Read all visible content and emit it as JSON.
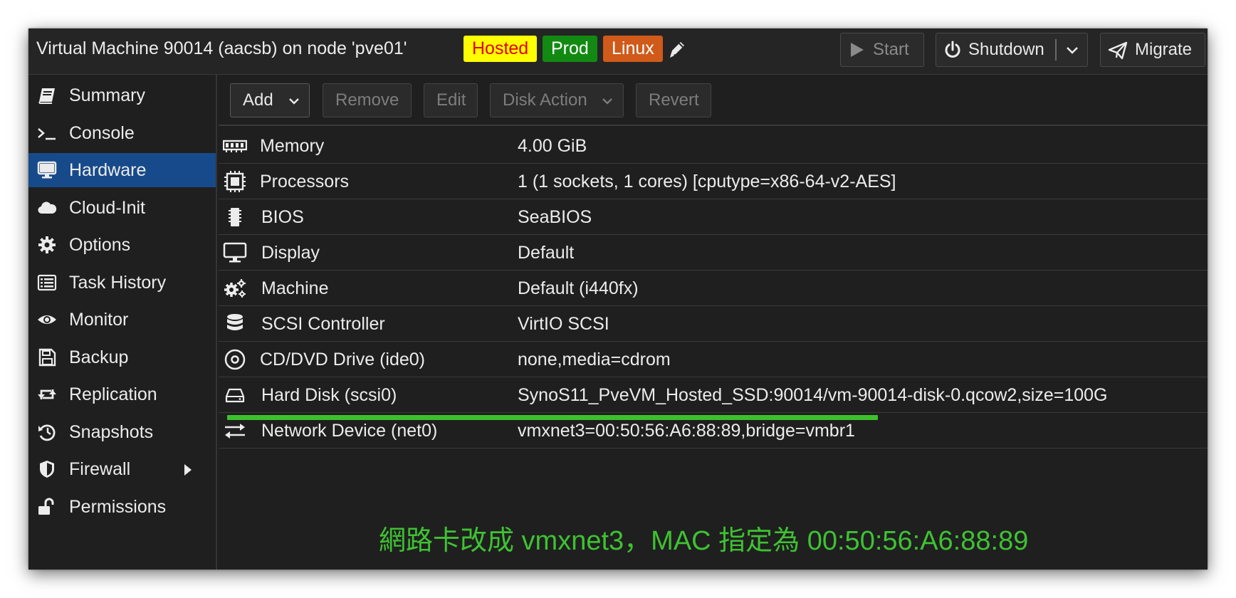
{
  "header": {
    "title": "Virtual Machine 90014 (aacsb) on node 'pve01'",
    "tags": [
      {
        "label": "Hosted",
        "bg": "#ffff00",
        "fg": "#e00000"
      },
      {
        "label": "Prod",
        "bg": "#128a12",
        "fg": "#ffffff"
      },
      {
        "label": "Linux",
        "bg": "#d05a1a",
        "fg": "#ffffff"
      }
    ],
    "edit_tags_icon": "pencil-icon",
    "buttons": {
      "start": {
        "label": "Start",
        "icon": "play-icon",
        "enabled": false
      },
      "shutdown": {
        "label": "Shutdown",
        "icon": "power-icon",
        "has_menu": true
      },
      "migrate": {
        "label": "Migrate",
        "icon": "paper-plane-icon"
      }
    }
  },
  "sidebar": {
    "items": [
      {
        "label": "Summary",
        "icon": "book-icon"
      },
      {
        "label": "Console",
        "icon": "terminal-icon"
      },
      {
        "label": "Hardware",
        "icon": "desktop-icon",
        "active": true
      },
      {
        "label": "Cloud-Init",
        "icon": "cloud-icon"
      },
      {
        "label": "Options",
        "icon": "gear-icon"
      },
      {
        "label": "Task History",
        "icon": "list-icon"
      },
      {
        "label": "Monitor",
        "icon": "eye-icon"
      },
      {
        "label": "Backup",
        "icon": "floppy-icon"
      },
      {
        "label": "Replication",
        "icon": "retweet-icon"
      },
      {
        "label": "Snapshots",
        "icon": "history-icon"
      },
      {
        "label": "Firewall",
        "icon": "shield-icon",
        "expandable": true
      },
      {
        "label": "Permissions",
        "icon": "unlock-icon"
      }
    ]
  },
  "toolbar": {
    "add": "Add",
    "remove": "Remove",
    "edit": "Edit",
    "disk_action": "Disk Action",
    "revert": "Revert"
  },
  "hardware": {
    "rows": [
      {
        "name": "Memory",
        "value": "4.00 GiB",
        "icon": "memory-icon"
      },
      {
        "name": "Processors",
        "value": "1 (1 sockets, 1 cores) [cputype=x86-64-v2-AES]",
        "icon": "cpu-icon"
      },
      {
        "name": "BIOS",
        "value": "SeaBIOS",
        "icon": "microchip-icon"
      },
      {
        "name": "Display",
        "value": "Default",
        "icon": "desktop-icon"
      },
      {
        "name": "Machine",
        "value": "Default (i440fx)",
        "icon": "cogs-icon"
      },
      {
        "name": "SCSI Controller",
        "value": "VirtIO SCSI",
        "icon": "database-icon"
      },
      {
        "name": "CD/DVD Drive (ide0)",
        "value": "none,media=cdrom",
        "icon": "cdrom-icon"
      },
      {
        "name": "Hard Disk (scsi0)",
        "value": "SynoS11_PveVM_Hosted_SSD:90014/vm-90014-disk-0.qcow2,size=100G",
        "icon": "hdd-icon"
      },
      {
        "name": "Network Device (net0)",
        "value": "vmxnet3=00:50:56:A6:88:89,bridge=vmbr1",
        "icon": "exchange-icon"
      }
    ]
  },
  "annotation": {
    "text": "網路卡改成 vmxnet3，MAC 指定為 00:50:56:A6:88:89",
    "color": "#3ec232"
  }
}
